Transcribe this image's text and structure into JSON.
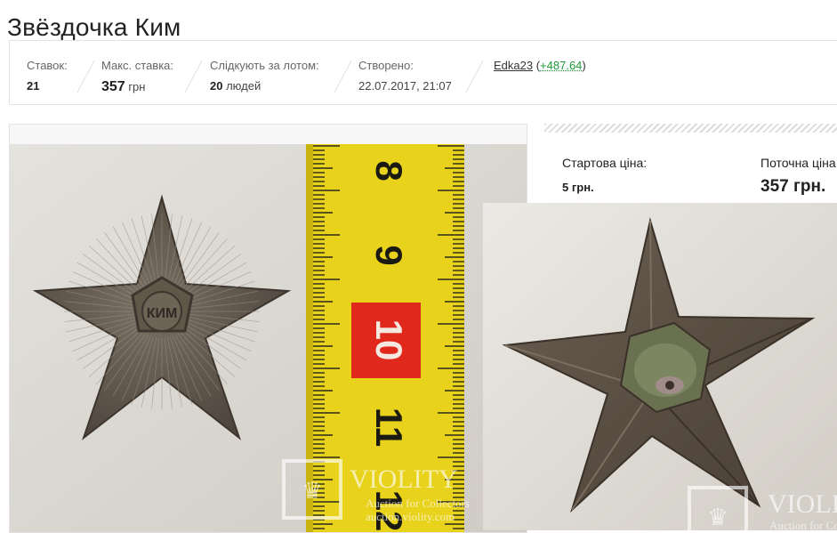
{
  "lot": {
    "title": "Звёздочка Ким"
  },
  "stats": {
    "bids_label": "Ставок:",
    "bids_value": "21",
    "max_bid_label": "Макс. ставка:",
    "max_bid_value": "357",
    "max_bid_currency": " грн",
    "watchers_label": "Слідкують за лотом:",
    "watchers_value": "20",
    "watchers_suffix": " людей",
    "created_label": "Створено:",
    "created_value": "22.07.2017, 21:07"
  },
  "seller": {
    "name": "Edka23",
    "rating_open": " (",
    "rating": "+487.64",
    "rating_close": ")"
  },
  "price": {
    "start_label": "Стартова ціна:",
    "start_value": "5 грн.",
    "current_label": "Поточна ціна",
    "current_value": "357 грн."
  },
  "watermark": {
    "brand": "VIOLITY",
    "tagline": "Auction for Collectors",
    "url": "auction.violity.com"
  },
  "ruler": {
    "numbers": [
      "8",
      "9",
      "10",
      "11",
      "12"
    ]
  },
  "badge_text": "КИМ",
  "colors": {
    "rating_green": "#1e9a38",
    "ruler_yellow": "#e8d21c",
    "ruler_red": "#e0281c",
    "star_bronze": "#5e5449"
  }
}
